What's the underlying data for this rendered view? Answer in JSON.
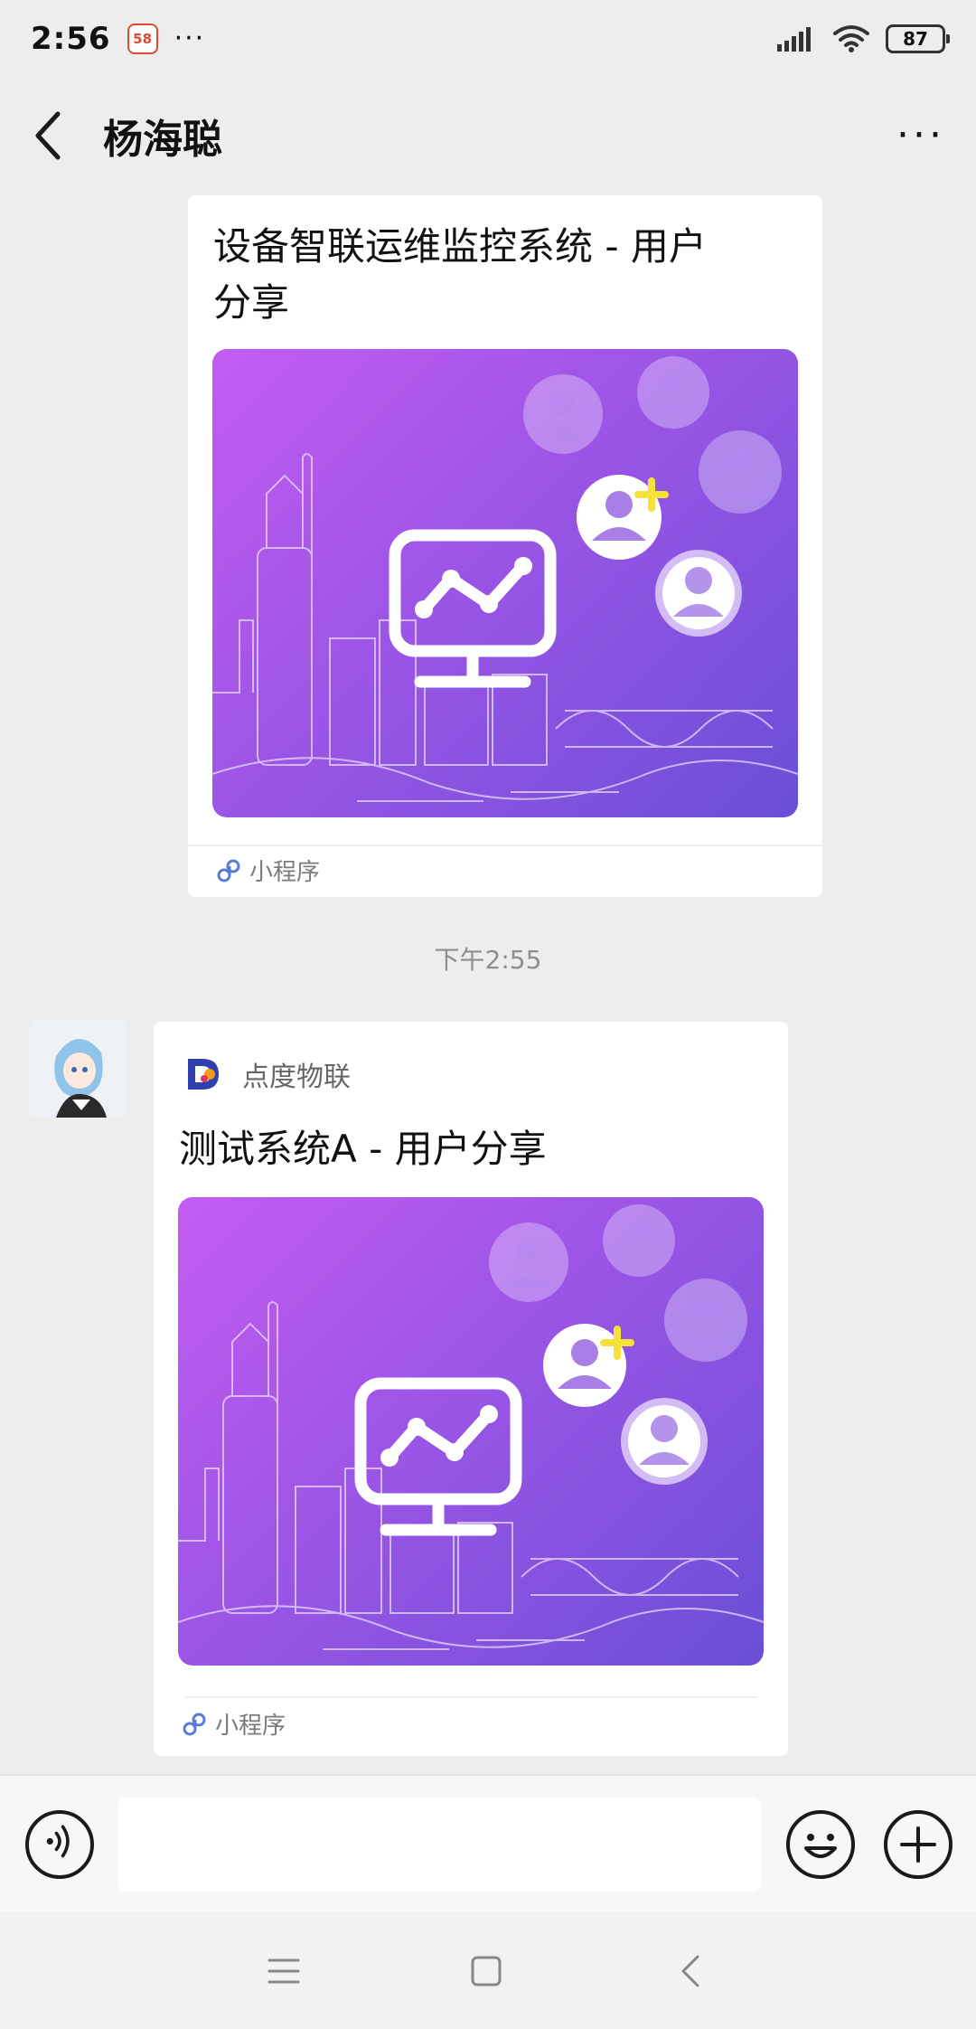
{
  "status_bar": {
    "time": "2:56",
    "app_badge": "58",
    "dots": "···",
    "battery": "87"
  },
  "nav": {
    "title": "杨海聪",
    "more": "···"
  },
  "messages": [
    {
      "title_line1": "设备智联运维监控系统 - 用户",
      "title_line2": "分享",
      "footer": "小程序"
    },
    {
      "timestamp": "下午2:55",
      "brand_name": "点度物联",
      "title": "测试系统A - 用户分享",
      "footer": "小程序"
    }
  ],
  "colors": {
    "background": "#ededed",
    "card_gradient_start": "#c35cf0",
    "card_gradient_end": "#6a4fd6",
    "plus_accent": "#f4e23a",
    "mini_program_icon": "#5b7bd5"
  },
  "icons": {
    "back": "chevron-left-icon",
    "more": "more-dots-icon",
    "voice": "voice-icon",
    "emoji": "emoji-icon",
    "plus": "plus-icon",
    "mini_program": "mini-program-icon",
    "home": "home-icon",
    "menu": "menu-icon",
    "nav_back": "back-icon"
  }
}
